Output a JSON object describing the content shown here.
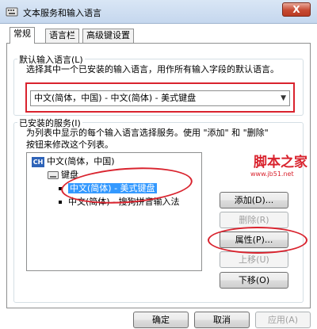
{
  "window": {
    "title": "文本服务和输入语言",
    "close_glyph": "X"
  },
  "tabs": [
    {
      "label": "常规"
    },
    {
      "label": "语言栏"
    },
    {
      "label": "高级键设置"
    }
  ],
  "default_input": {
    "legend": "默认输入语言(L)",
    "description": "选择其中一个已安装的输入语言，用作所有输入字段的默认语言。",
    "selected_value": "中文(简体，中国) - 中文(简体) - 美式键盘"
  },
  "installed_services": {
    "legend": "已安装的服务(I)",
    "description_line1": "为列表中显示的每个输入语言选择服务。使用 \"添加\" 和 \"删除\"",
    "description_line2": "按钮来修改这个列表。",
    "tree": {
      "language_badge": "CH",
      "language": "中文(简体，中国)",
      "category": "键盘",
      "items": [
        "中文(简体) - 美式键盘",
        "中文(简体) - 搜狗拼音输入法"
      ]
    },
    "buttons": {
      "add": "添加(D)...",
      "remove": "删除(R)",
      "properties": "属性(P)...",
      "move_up": "上移(U)",
      "move_down": "下移(O)"
    }
  },
  "footer": {
    "ok": "确定",
    "cancel": "取消",
    "apply": "应用(A)"
  },
  "watermark": {
    "main": "脚本之家",
    "url": "www.jb51.net"
  },
  "colors": {
    "annotation": "#d9232e",
    "selection": "#3399ff",
    "language_badge": "#2e63b8"
  }
}
